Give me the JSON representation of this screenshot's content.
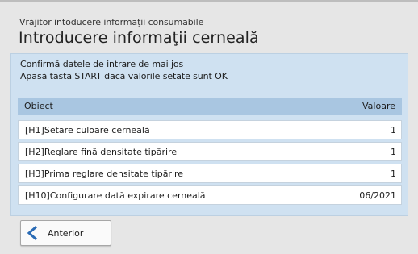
{
  "header": {
    "subtitle": "Vrăjitor intoducere informaţii consumabile",
    "title": "Introducere informaţii cerneală"
  },
  "panel": {
    "message_line1": "Confirmă datele de intrare de mai jos",
    "message_line2": "Apasă tasta START dacă valorile setate sunt OK"
  },
  "table": {
    "columns": [
      "Obiect",
      "Valoare"
    ],
    "rows": [
      {
        "item": "[H1]Setare culoare cerneală",
        "value": "1"
      },
      {
        "item": "[H2]Reglare fină densitate tipărire",
        "value": "1"
      },
      {
        "item": "[H3]Prima reglare densitate tipărire",
        "value": "1"
      },
      {
        "item": "[H10]Configurare dată expirare cerneală",
        "value": "06/2021"
      }
    ]
  },
  "footer": {
    "prev_label": "Anterior",
    "prev_icon": "chevron-left-icon"
  },
  "colors": {
    "accent": "#2a6bb5",
    "panel_bg": "#cfe1f1",
    "table_header_bg": "#a9c6e1"
  }
}
